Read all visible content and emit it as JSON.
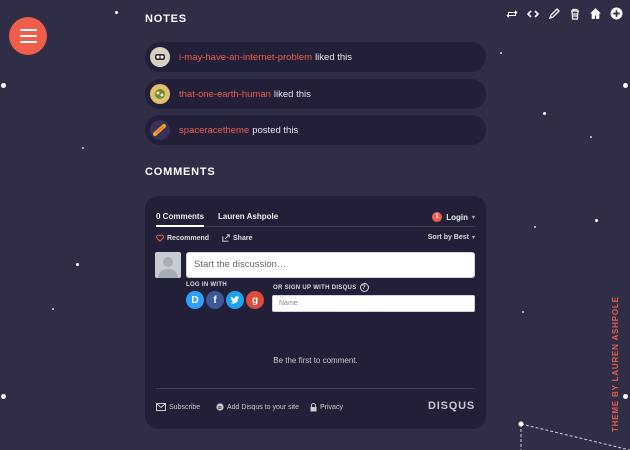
{
  "topbar": {
    "icons": [
      "reblog-icon",
      "embed-icon",
      "edit-icon",
      "delete-icon",
      "home-icon",
      "follow-icon"
    ]
  },
  "menu": {
    "icon": "hamburger-icon"
  },
  "notes": {
    "title": "NOTES",
    "items": [
      {
        "user": "i-may-have-an-internet-problem",
        "action": "liked this"
      },
      {
        "user": "that-one-earth-human",
        "action": "liked this"
      },
      {
        "user": "spaceracetheme",
        "action": "posted this"
      }
    ]
  },
  "comments": {
    "title": "COMMENTS",
    "disqus": {
      "tab_comments": "0 Comments",
      "tab_user": "Lauren Ashpole",
      "login_badge": "1",
      "login_label": "Login",
      "recommend_label": "Recommend",
      "share_label": "Share",
      "sort_label": "Sort by Best",
      "input_placeholder": "Start the discussion…",
      "log_in_with": "LOG IN WITH",
      "sign_up_label": "OR SIGN UP WITH DISQUS",
      "help_icon": "?",
      "name_placeholder": "Name",
      "empty_text": "Be the first to comment.",
      "subscribe": "Subscribe",
      "add_disqus": "Add Disqus to your site",
      "privacy": "Privacy",
      "logo": "DISQUS",
      "social": [
        {
          "letter": "D",
          "name": "disqus-login",
          "color": "#2e9fff"
        },
        {
          "letter": "f",
          "name": "facebook-login",
          "color": "#3b5998"
        },
        {
          "letter": "t",
          "name": "twitter-login",
          "color": "#1da1f2"
        },
        {
          "letter": "g",
          "name": "google-login",
          "color": "#dd4b39"
        }
      ]
    }
  },
  "credit": "THEME BY LAUREN ASHPOLE",
  "colors": {
    "background": "#302d46",
    "panel": "#221f38",
    "accent": "#ef5d4b"
  }
}
